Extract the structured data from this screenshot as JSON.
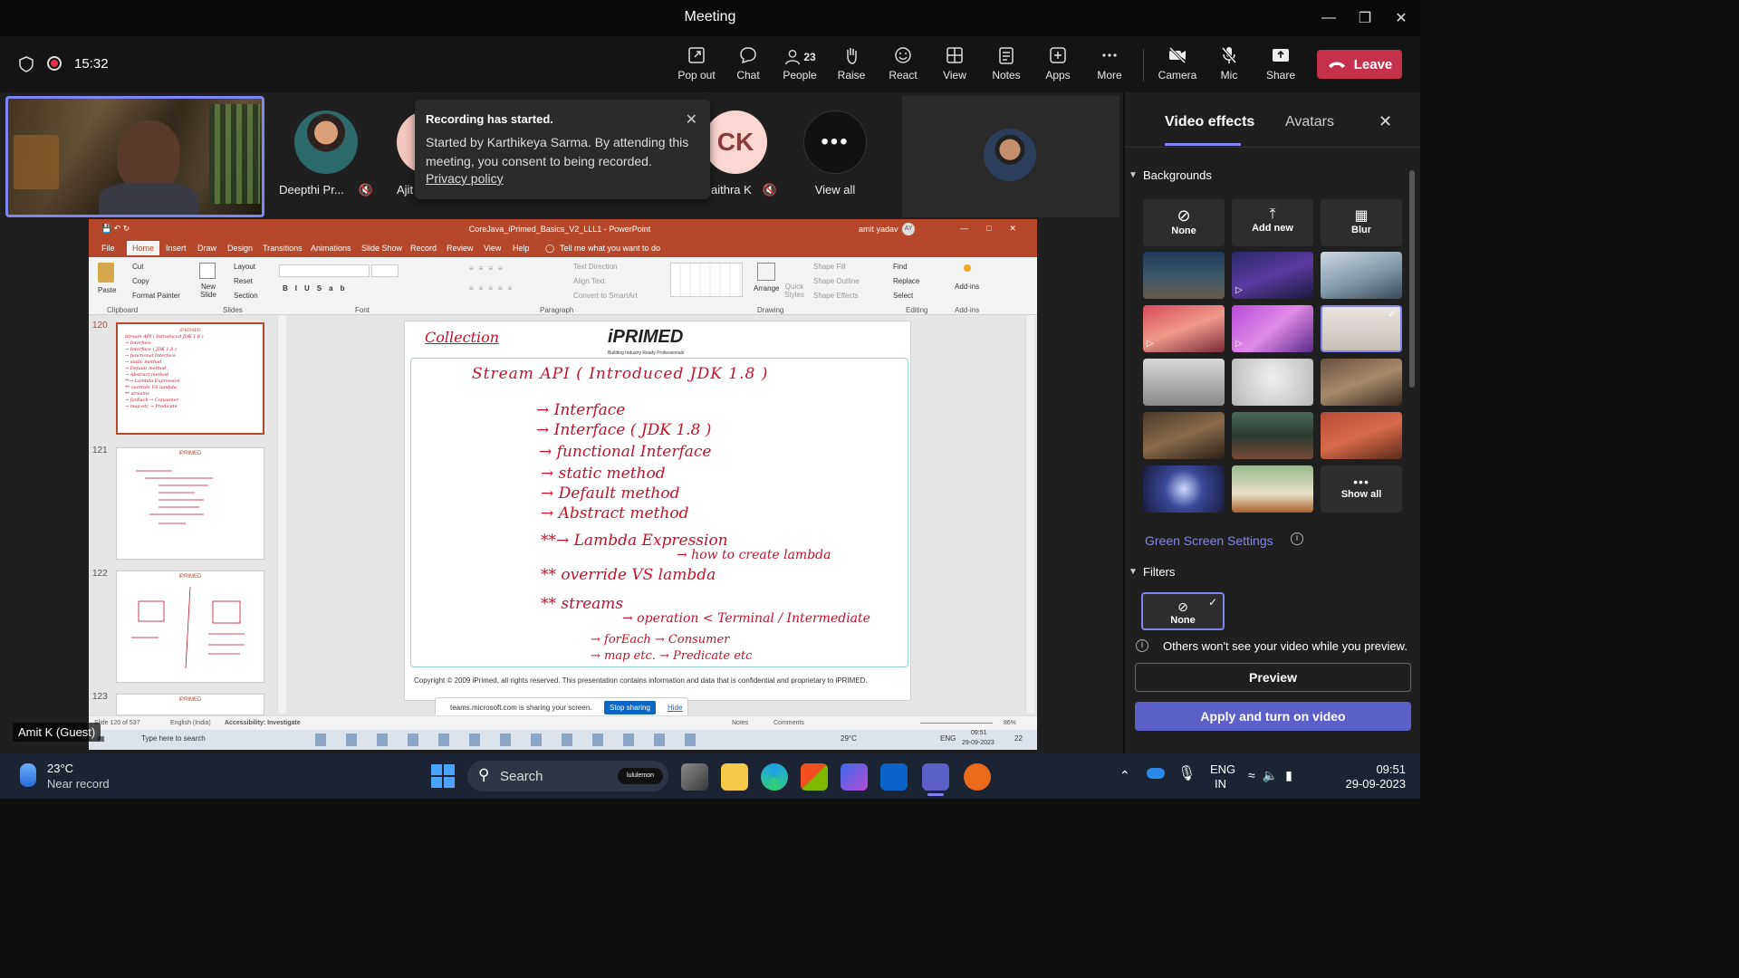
{
  "window": {
    "title": "Meeting"
  },
  "meeting": {
    "time": "15:32"
  },
  "toolbar": {
    "items": [
      {
        "label": "Pop out"
      },
      {
        "label": "Chat"
      },
      {
        "label": "People",
        "count": "23"
      },
      {
        "label": "Raise"
      },
      {
        "label": "React"
      },
      {
        "label": "View"
      },
      {
        "label": "Notes"
      },
      {
        "label": "Apps"
      },
      {
        "label": "More"
      },
      {
        "label": "Camera"
      },
      {
        "label": "Mic"
      },
      {
        "label": "Share"
      }
    ],
    "leave_label": "Leave"
  },
  "participants": [
    {
      "name": "Deepthi Pr..."
    },
    {
      "name": "Ajit"
    },
    {
      "initials": "CK",
      "name": "aithra K"
    },
    {
      "name": "View all"
    }
  ],
  "recording_toast": {
    "title": "Recording has started.",
    "message": "Started by Karthikeya Sarma. By attending this meeting, you consent to being recorded.",
    "link": "Privacy policy"
  },
  "powerpoint": {
    "title": "CoreJava_iPrimed_Basics_V2_LLL1 - PowerPoint",
    "user": "amit yadav",
    "user_initials": "AY",
    "tabs": [
      "File",
      "Home",
      "Insert",
      "Draw",
      "Design",
      "Transitions",
      "Animations",
      "Slide Show",
      "Record",
      "Review",
      "View",
      "Help"
    ],
    "tell_me": "Tell me what you want to do",
    "ribbon": {
      "clipboard": {
        "paste": "Paste",
        "cut": "Cut",
        "copy": "Copy",
        "format_painter": "Format Painter",
        "group": "Clipboard"
      },
      "slides": {
        "new_slide": "New Slide",
        "layout": "Layout",
        "reset": "Reset",
        "section": "Section",
        "group": "Slides"
      },
      "font_group": "Font",
      "paragraph": {
        "text_direction": "Text Direction",
        "align_text": "Align Text",
        "convert": "Convert to SmartArt",
        "group": "Paragraph"
      },
      "drawing": {
        "arrange": "Arrange",
        "quick_styles": "Quick Styles",
        "shape_fill": "Shape Fill",
        "shape_outline": "Shape Outline",
        "shape_effects": "Shape Effects",
        "group": "Drawing"
      },
      "editing": {
        "find": "Find",
        "replace": "Replace",
        "select": "Select",
        "group": "Editing"
      },
      "addins": {
        "label": "Add-ins",
        "group": "Add-ins"
      }
    },
    "slide_numbers": [
      "120",
      "121",
      "122",
      "123"
    ],
    "slide": {
      "logo": "iPRIMED",
      "tagline": "Building Industry Ready Professionals",
      "lines": [
        "Collection",
        "Stream API ( Introduced JDK 1.8 )",
        "→ Interface",
        "→ Interface ( JDK 1.8 )",
        "→ functional Interface",
        "→ static method",
        "→ Default method",
        "→ Abstract method",
        "**→ Lambda Expression",
        "→ how to create lambda",
        "** override VS lambda",
        "** streams",
        "→ operation < Terminal / Intermediate",
        "→ forEach → Consumer",
        "→ map etc. → Predicate etc"
      ],
      "footer": "Copyright © 2009 iPrimed, all rights reserved. This presentation contains information and data that is confidential and proprietary to iPRIMED."
    },
    "status": {
      "slide": "Slide 120 of 537",
      "lang": "English (India)",
      "accessibility": "Accessibility: Investigate",
      "notes": "Notes",
      "comments": "Comments",
      "zoom": "86%"
    },
    "share_bar": {
      "text": "teams.microsoft.com is sharing your screen.",
      "stop": "Stop sharing",
      "hide": "Hide"
    },
    "inner_taskbar": {
      "search": "Type here to search",
      "temp": "29°C",
      "lang": "ENG",
      "time": "09:51",
      "date": "29-09-2023",
      "badge": "22"
    }
  },
  "presenter_label": "Amit K (Guest)",
  "side_panel": {
    "tabs": [
      "Video effects",
      "Avatars"
    ],
    "backgrounds_label": "Backgrounds",
    "options": [
      {
        "label": "None"
      },
      {
        "label": "Add new"
      },
      {
        "label": "Blur"
      }
    ],
    "show_all": "Show all",
    "green_screen": "Green Screen Settings",
    "filters_label": "Filters",
    "filter_none": "None",
    "info_text": "Others won't see your video while you preview.",
    "preview": "Preview",
    "apply": "Apply and turn on video",
    "colors": {
      "accent": "#7f85f5",
      "apply_bg": "#5b5fc7"
    }
  },
  "taskbar": {
    "weather_temp": "23°C",
    "weather_desc": "Near record",
    "search": "Search",
    "badge": "lululemon",
    "lang_top": "ENG",
    "lang_bottom": "IN",
    "time": "09:51",
    "date": "29-09-2023"
  }
}
